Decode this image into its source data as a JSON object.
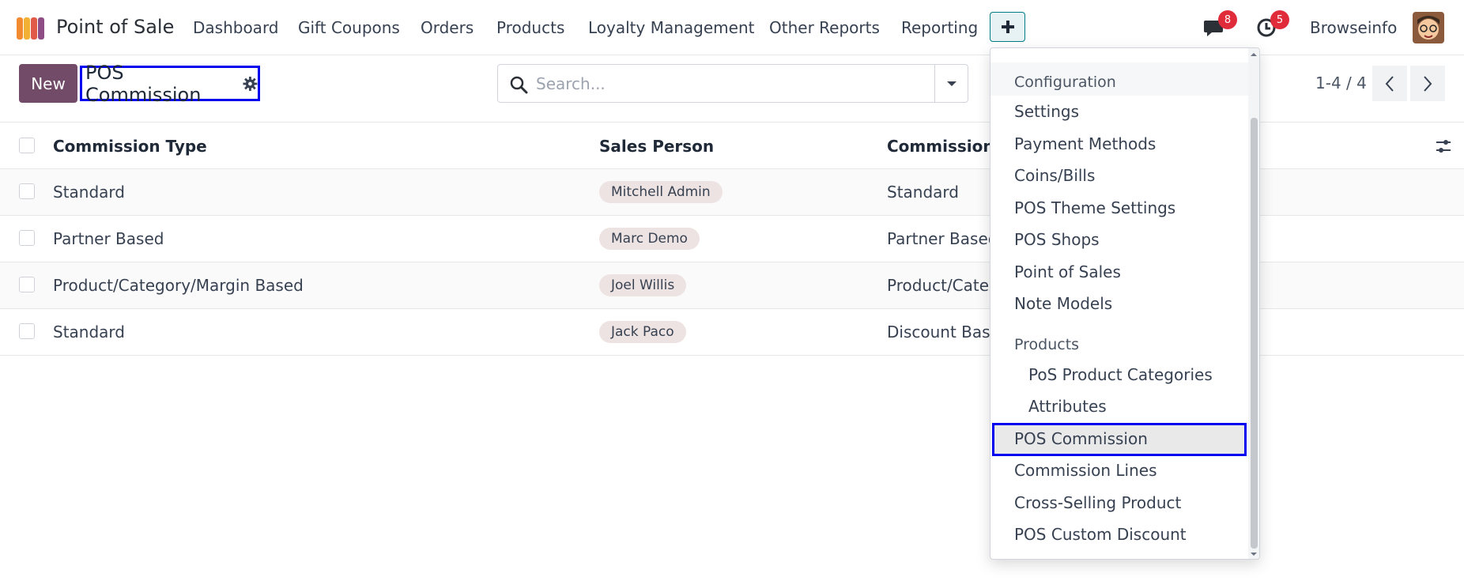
{
  "topnav": {
    "app_name": "Point of Sale",
    "menu": [
      "Dashboard",
      "Gift Coupons",
      "Orders",
      "Products",
      "Loyalty Management",
      "Other Reports",
      "Reporting"
    ],
    "messages_count": "8",
    "activities_count": "5",
    "user_name": "Browseinfo"
  },
  "control": {
    "new_label": "New",
    "breadcrumb": "POS Commission",
    "search_placeholder": "Search...",
    "pager": "1-4 / 4"
  },
  "table": {
    "columns": [
      "Commission Type",
      "Sales Person",
      "Commission N"
    ],
    "rows": [
      {
        "type": "Standard",
        "salesperson": "Mitchell Admin",
        "name": "Standard"
      },
      {
        "type": "Partner Based",
        "salesperson": "Marc Demo",
        "name": "Partner Based"
      },
      {
        "type": "Product/Category/Margin Based",
        "salesperson": "Joel Willis",
        "name": "Product/Categ"
      },
      {
        "type": "Standard",
        "salesperson": "Jack Paco",
        "name": "Discount Base"
      }
    ]
  },
  "dropdown": {
    "section_configuration": "Configuration",
    "config_items": [
      "Settings",
      "Payment Methods",
      "Coins/Bills",
      "POS Theme Settings",
      "POS Shops",
      "Point of Sales",
      "Note Models"
    ],
    "section_products": "Products",
    "product_items": [
      "PoS Product Categories",
      "Attributes"
    ],
    "more_items": [
      "POS Commission",
      "Commission Lines",
      "Cross-Selling Product",
      "POS Custom Discount"
    ]
  },
  "colors": {
    "brand": "#714b67",
    "highlight": "#0000ee",
    "badge": "#e02b3a",
    "tag_bg": "#ede3e2"
  }
}
